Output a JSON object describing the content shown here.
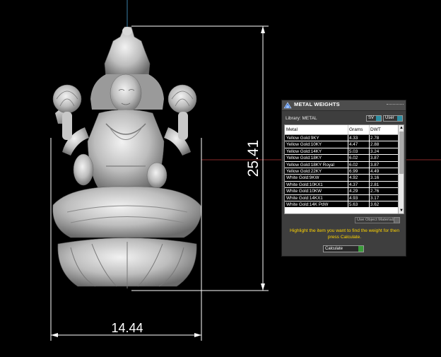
{
  "viewport": {
    "height_dimension": "25.41",
    "width_dimension": "14.44"
  },
  "panel": {
    "title": "METAL WEIGHTS",
    "library_label": "Library: METAL",
    "sv_button": "SV",
    "user_button": "User",
    "columns": {
      "metal": "Metal",
      "grams": "Grams",
      "dwt": "DWT"
    },
    "rows": [
      {
        "metal": "Yellow Gold:9KY",
        "grams": "4.33",
        "dwt": "2.78"
      },
      {
        "metal": "Yellow Gold:10KY",
        "grams": "4.47",
        "dwt": "2.88"
      },
      {
        "metal": "Yellow Gold:14KY",
        "grams": "5.03",
        "dwt": "3.24"
      },
      {
        "metal": "Yellow Gold:18KY",
        "grams": "6.02",
        "dwt": "3.87"
      },
      {
        "metal": "Yellow Gold:18KY Royal",
        "grams": "6.02",
        "dwt": "3.87"
      },
      {
        "metal": "Yellow Gold:22KY",
        "grams": "6.99",
        "dwt": "4.49"
      },
      {
        "metal": "White Gold:9KW",
        "grams": "4.92",
        "dwt": "3.16"
      },
      {
        "metal": "White Gold:10KX1",
        "grams": "4.37",
        "dwt": "2.81"
      },
      {
        "metal": "White Gold:10KW",
        "grams": "4.29",
        "dwt": "2.76"
      },
      {
        "metal": "White Gold:14KX1",
        "grams": "4.93",
        "dwt": "3.17"
      },
      {
        "metal": "White Gold:14K PdW",
        "grams": "5.63",
        "dwt": "3.62"
      }
    ],
    "use_object_materials": "Use Object Materials",
    "instruction": "Highlight the item you want to find the weight for then press Calculate.",
    "calculate_option": "Calculate",
    "colors": {
      "instruction_text": "#ffd400",
      "indicator": "#2e8fa3",
      "dimension_lines": "#ffffff"
    }
  }
}
